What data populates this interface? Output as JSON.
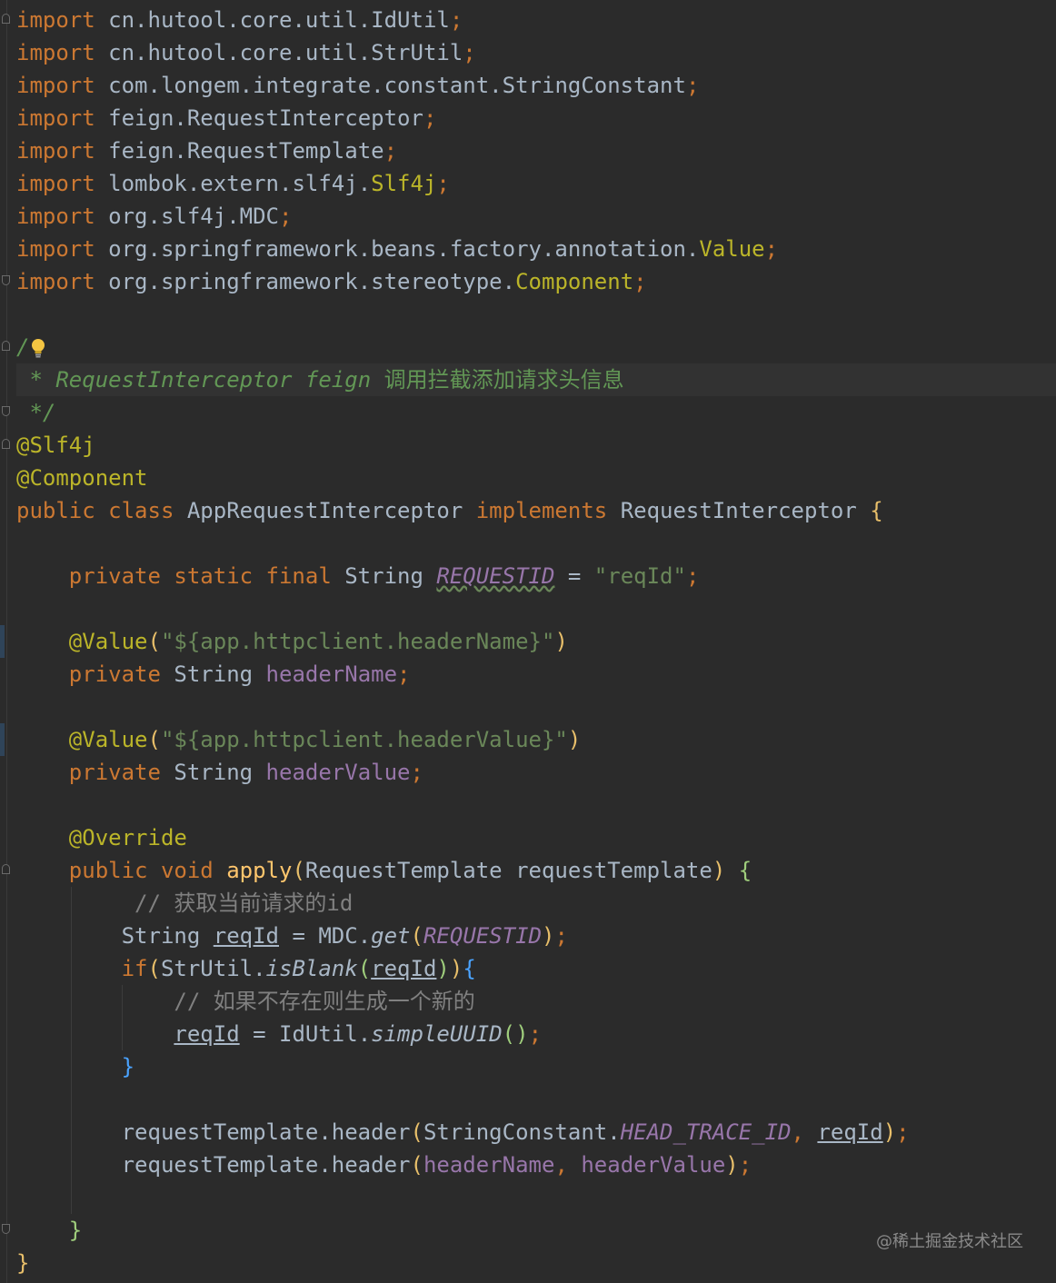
{
  "editor": {
    "imports": [
      {
        "kw": "import",
        "pkg": "cn.hutool.core.util.",
        "cls": "IdUtil"
      },
      {
        "kw": "import",
        "pkg": "cn.hutool.core.util.",
        "cls": "StrUtil"
      },
      {
        "kw": "import",
        "pkg": "com.longem.integrate.constant.",
        "cls": "StringConstant"
      },
      {
        "kw": "import",
        "pkg": "feign.",
        "cls": "RequestInterceptor"
      },
      {
        "kw": "import",
        "pkg": "feign.",
        "cls": "RequestTemplate"
      },
      {
        "kw": "import",
        "pkg": "lombok.extern.slf4j.",
        "cls": "Slf4j"
      },
      {
        "kw": "import",
        "pkg": "org.slf4j.",
        "cls": "MDC"
      },
      {
        "kw": "import",
        "pkg": "org.springframework.beans.factory.annotation.",
        "cls": "Value"
      },
      {
        "kw": "import",
        "pkg": "org.springframework.stereotype.",
        "cls": "Component"
      }
    ],
    "semicolon": ";",
    "doc": {
      "open": "/",
      "star": " * ",
      "text_en": "RequestInterceptor feign ",
      "text_zh": "调用拦截添加请求头信息",
      "close": " */"
    },
    "annotations": {
      "slf4j": "@Slf4j",
      "component": "@Component",
      "override": "@Override",
      "value": "@Value"
    },
    "class_decl": {
      "modifier": "public class ",
      "name": "AppRequestInterceptor ",
      "implements": "implements ",
      "iface": "RequestInterceptor ",
      "brace": "{"
    },
    "const_field": {
      "mods": "private static final ",
      "type": "String ",
      "name": "REQUESTID",
      "eq": " = ",
      "value": "\"reqId\""
    },
    "value1": {
      "arg": "\"${app.httpclient.headerName}\"",
      "mods": "private ",
      "type": "String ",
      "name": "headerName"
    },
    "value2": {
      "arg": "\"${app.httpclient.headerValue}\"",
      "mods": "private ",
      "type": "String ",
      "name": "headerValue"
    },
    "method": {
      "mods": "public void ",
      "name": "apply",
      "param": "RequestTemplate requestTemplate",
      "comment1": "// 获取当前请求的id",
      "decl_type": "String ",
      "var": "reqId",
      "eq": " = ",
      "mdc": "MDC.",
      "get": "get",
      "const_ref": "REQUESTID",
      "if_kw": "if",
      "strutil": "StrUtil.",
      "isblank": "isBlank",
      "comment2": "// 如果不存在则生成一个新的",
      "idutil": "IdUtil.",
      "simpleuuid": "simpleUUID",
      "call1_obj": "requestTemplate.header",
      "call1_cls": "StringConstant.",
      "call1_const": "HEAD_TRACE_ID",
      "call2_obj": "requestTemplate.header",
      "call2_a": "headerName",
      "call2_b": "headerValue",
      "comma": ", "
    },
    "closing_brace": "}"
  },
  "watermark": "@稀土掘金技术社区",
  "colors": {
    "background": "#2b2b2b",
    "keyword": "#cc7832",
    "annotation": "#bbb529",
    "string": "#6a8759",
    "field": "#9876aa",
    "method": "#ffc66d",
    "comment": "#808080",
    "doc_comment": "#629755",
    "text": "#a9b7c6"
  }
}
